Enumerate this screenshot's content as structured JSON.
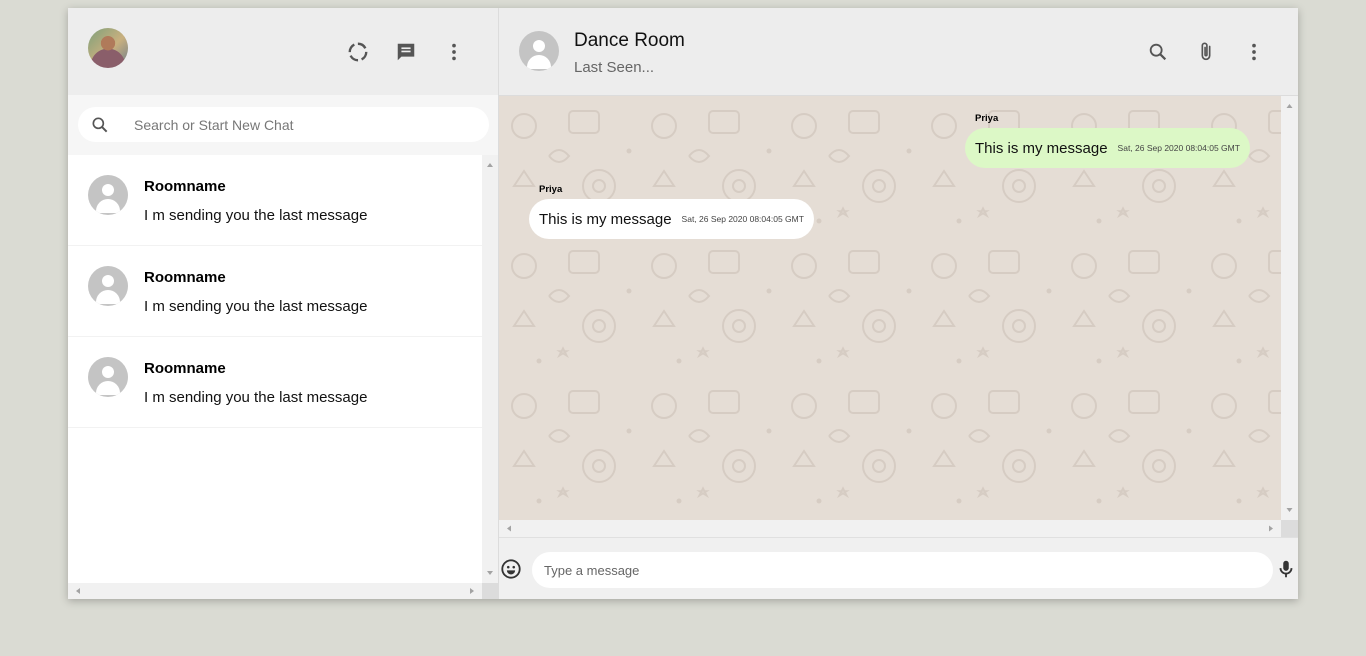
{
  "sidebar": {
    "search_placeholder": "Search or Start New Chat",
    "icons": [
      "status-icon",
      "new-chat-icon",
      "more-vert-icon"
    ],
    "chats": [
      {
        "name": "Roomname",
        "last_message": "I m sending you the last message"
      },
      {
        "name": "Roomname",
        "last_message": "I m sending you the last message"
      },
      {
        "name": "Roomname",
        "last_message": "I m sending you the last message"
      }
    ]
  },
  "chat": {
    "room_name": "Dance Room",
    "status": "Last Seen...",
    "header_icons": [
      "search-icon",
      "attach-icon",
      "more-vert-icon"
    ],
    "messages": [
      {
        "sender": "Priya",
        "text": "This is my message",
        "timestamp": "Sat, 26 Sep 2020 08:04:05 GMT",
        "type": "sent"
      },
      {
        "sender": "Priya",
        "text": "This is my message",
        "timestamp": "Sat, 26 Sep 2020 08:04:05 GMT",
        "type": "received"
      }
    ],
    "input_placeholder": "Type a message",
    "footer_icons": [
      "emoji-icon",
      "mic-icon"
    ]
  },
  "colors": {
    "page_bg": "#dadbd3",
    "header_bg": "#ededed",
    "chat_bg": "#e5ddd5",
    "sent_bubble": "#dcf8c6",
    "received_bubble": "#ffffff"
  }
}
